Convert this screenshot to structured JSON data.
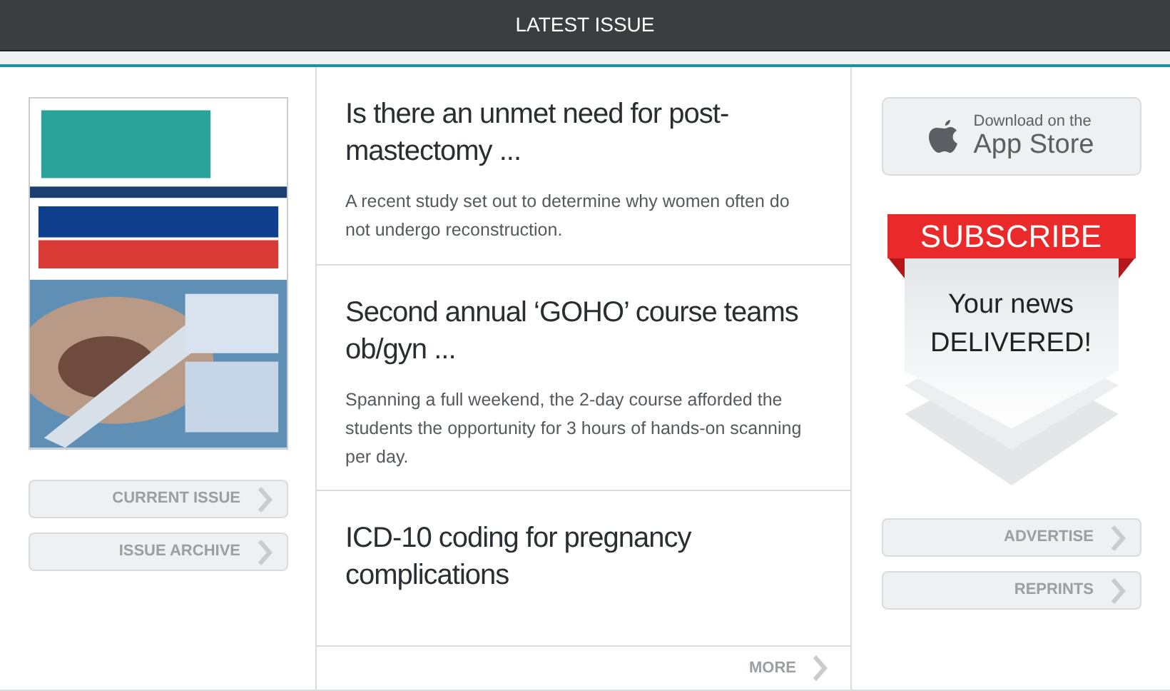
{
  "header": {
    "title": "LATEST ISSUE"
  },
  "cover": {
    "kind": "picture"
  },
  "left_links": [
    "CURRENT ISSUE",
    "ISSUE ARCHIVE"
  ],
  "articles": [
    {
      "title": "Is there an unmet need for post-mastectomy ...",
      "summary": "A recent study set out to determine why women often do not undergo reconstruction."
    },
    {
      "title": "Second annual ‘GOHO’ course teams ob/gyn ...",
      "summary": "Spanning a full weekend, the 2-day course afforded the students the opportunity for 3 hours of hands-on scanning per day."
    },
    {
      "title": "ICD-10 coding for pregnancy complications"
    }
  ],
  "more": "MORE",
  "app_store": {
    "line1": "Download on the",
    "line2": "App Store"
  },
  "subscribe": {
    "ribbon": "SUBSCRIBE",
    "line1": "Your news",
    "line2": "DELIVERED!"
  },
  "right_links": [
    "ADVERTISE",
    "REPRINTS"
  ]
}
